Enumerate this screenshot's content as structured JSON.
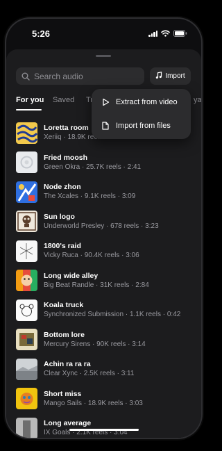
{
  "status_bar": {
    "time": "5:26"
  },
  "search": {
    "placeholder": "Search audio"
  },
  "import_button": {
    "label": "Import"
  },
  "tabs": [
    {
      "label": "For you",
      "active": true
    },
    {
      "label": "Saved",
      "active": false
    },
    {
      "label": "Tr",
      "active": false
    },
    {
      "label": "ya",
      "active": false
    }
  ],
  "import_menu": {
    "items": [
      {
        "label": "Extract from video",
        "icon": "play-icon"
      },
      {
        "label": "Import from files",
        "icon": "file-icon"
      }
    ]
  },
  "tracks": [
    {
      "title": "Loretta room",
      "subtitle": "Xeriiq · 18.9K reels",
      "art": "yellow-swirl"
    },
    {
      "title": "Fried moosh",
      "subtitle": "Green Okra · 25.7K reels · 2:41",
      "art": "grey-circle"
    },
    {
      "title": "Node zhon",
      "subtitle": "The Xcales · 9.1K reels · 3:09",
      "art": "blue-abstract"
    },
    {
      "title": "Sun logo",
      "subtitle": "Underworld Presley · 678 reels · 3:23",
      "art": "skull-pattern"
    },
    {
      "title": "1800's raid",
      "subtitle": "Vicky Ruca · 90.4K reels · 3:06",
      "art": "white-sketch"
    },
    {
      "title": "Long wide alley",
      "subtitle": "Big Beat Randle · 31K reels · 2:84",
      "art": "rainbow-face"
    },
    {
      "title": "Koala truck",
      "subtitle": "Synchronized Submission · 1.1K reels · 0:42",
      "art": "koala-sketch"
    },
    {
      "title": "Bottom lore",
      "subtitle": "Mercury Sirens · 90K reels · 3:14",
      "art": "olive-collage"
    },
    {
      "title": "Achin ra ra ra",
      "subtitle": "Clear Xync · 2.5K reels · 3:11",
      "art": "grey-landscape"
    },
    {
      "title": "Short miss",
      "subtitle": "Mango Sails · 18.9K reels · 3:03",
      "art": "colorful-face"
    },
    {
      "title": "Long average",
      "subtitle": "IX Goals · 2.1K reels · 3:04",
      "art": "grey-figure"
    }
  ]
}
